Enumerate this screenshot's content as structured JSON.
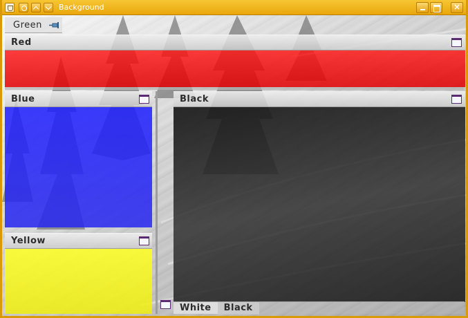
{
  "window": {
    "title": "Background"
  },
  "dock_toolbar": {
    "label": "Green"
  },
  "panels": {
    "red": {
      "title": "Red",
      "color": "#ee1111"
    },
    "blue": {
      "title": "Blue",
      "color": "#2020f8"
    },
    "yellow": {
      "title": "Yellow",
      "color": "#f4f420"
    },
    "black": {
      "title": "Black",
      "color": "#222222"
    }
  },
  "tabs": [
    {
      "label": "White"
    },
    {
      "label": "Black"
    }
  ],
  "icons": {
    "window_icon": "window-icon",
    "pin_icon": "pin-icon",
    "java_icon": "java-icon"
  },
  "accent": "#e9a70b"
}
